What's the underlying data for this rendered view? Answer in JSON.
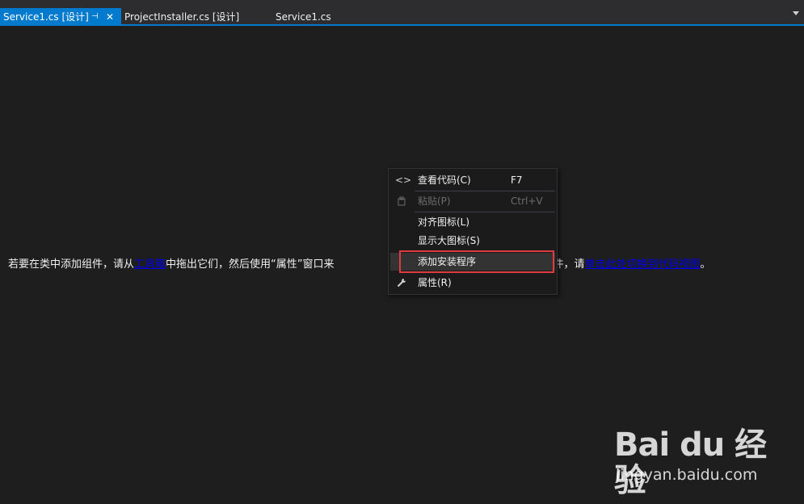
{
  "tabs": [
    {
      "label": "Service1.cs [设计]",
      "active": true
    },
    {
      "label": "ProjectInstaller.cs [设计]",
      "active": false
    },
    {
      "label": "Service1.cs",
      "active": false
    }
  ],
  "tab_icons": {
    "pin": "pin-icon",
    "close": "close-icon",
    "overflow": "chevron-down-icon"
  },
  "designer": {
    "text_before": "若要在类中添加组件，请从",
    "link_toolbox": "工具箱",
    "text_middle": "中拖出它们，然后使用“属性”窗口来",
    "text_after": "建方法和事件，请",
    "link_code": "单击此处切换到代码视图",
    "text_end": "。"
  },
  "context_menu": {
    "items": [
      {
        "label": "查看代码(C)",
        "shortcut": "F7",
        "icon": "code-icon",
        "enabled": true
      },
      {
        "label": "粘贴(P)",
        "shortcut": "Ctrl+V",
        "icon": "paste-icon",
        "enabled": false
      },
      {
        "label": "对齐图标(L)",
        "shortcut": "",
        "icon": "",
        "enabled": true
      },
      {
        "label": "显示大图标(S)",
        "shortcut": "",
        "icon": "",
        "enabled": true
      },
      {
        "label": "添加安装程序",
        "shortcut": "",
        "icon": "",
        "enabled": true,
        "highlighted": true
      },
      {
        "label": "属性(R)",
        "shortcut": "",
        "icon": "wrench-icon",
        "enabled": true
      }
    ]
  },
  "watermark": {
    "brand": "Bai du 经验",
    "site": "jingyan.baidu.com"
  },
  "colors": {
    "accent": "#007acc",
    "background": "#1e1e1e",
    "highlight": "#e0393e",
    "link": "#0000ee"
  }
}
